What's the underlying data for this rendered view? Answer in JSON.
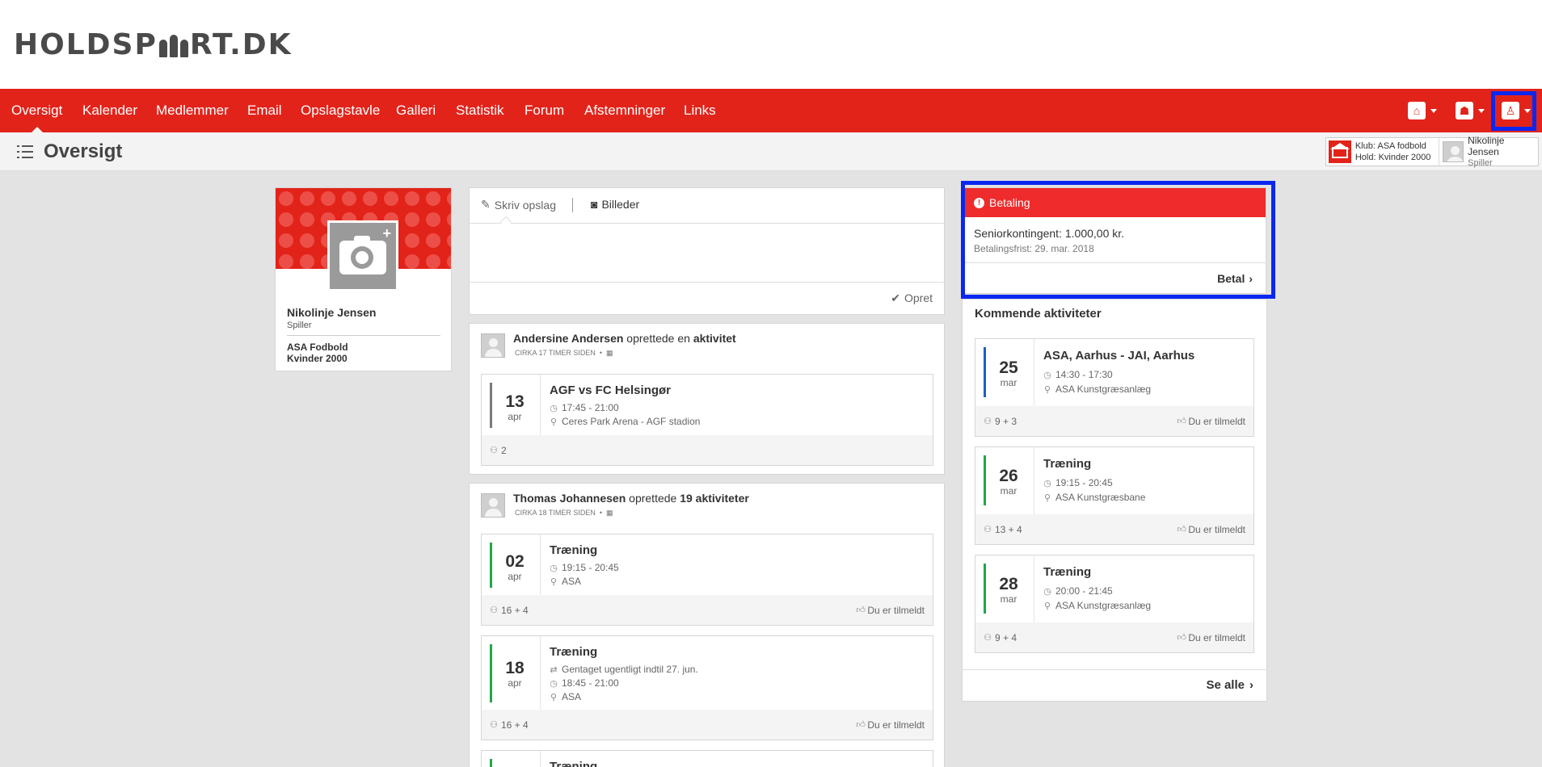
{
  "brand": {
    "logo": "HOLDSPORT.DK"
  },
  "nav": {
    "items": [
      {
        "label": "Oversigt"
      },
      {
        "label": "Kalender"
      },
      {
        "label": "Medlemmer"
      },
      {
        "label": "Email"
      },
      {
        "label": "Opslagstavle"
      },
      {
        "label": "Galleri"
      },
      {
        "label": "Statistik"
      },
      {
        "label": "Forum"
      },
      {
        "label": "Afstemninger"
      },
      {
        "label": "Links"
      }
    ]
  },
  "page": {
    "title": "Oversigt"
  },
  "context": {
    "club_label": "Klub: ASA fodbold",
    "team_label": "Hold: Kvinder 2000",
    "user_name": "Nikolinje Jensen",
    "user_role": "Spiller"
  },
  "profile": {
    "name": "Nikolinje Jensen",
    "role": "Spiller",
    "club": "ASA Fodbold",
    "team": "Kvinder 2000"
  },
  "composer": {
    "write_tab": "Skriv opslag",
    "images_tab": "Billeder",
    "create_button": "Opret"
  },
  "feed": [
    {
      "author": "Andersine Andersen",
      "verb": "oprettede en",
      "object": "aktivitet",
      "time": "CIRKA 17 TIMER SIDEN",
      "activities": [
        {
          "day": "13",
          "month": "apr",
          "title": "AGF vs FC Helsingør",
          "time": "17:45 - 21:00",
          "location": "Ceres Park Arena - AGF stadion",
          "count": "2",
          "status": ""
        }
      ]
    },
    {
      "author": "Thomas Johannesen",
      "verb": "oprettede",
      "object": "19 aktiviteter",
      "time": "CIRKA 18 TIMER SIDEN",
      "activities": [
        {
          "day": "02",
          "month": "apr",
          "title": "Træning",
          "time": "19:15 - 20:45",
          "location": "ASA",
          "count": "16 + 4",
          "status": "Du er tilmeldt"
        },
        {
          "day": "18",
          "month": "apr",
          "title": "Træning",
          "repeat": "Gentaget ugentligt indtil 27. jun.",
          "time": "18:45 - 21:00",
          "location": "ASA",
          "count": "16 + 4",
          "status": "Du er tilmeldt"
        },
        {
          "title": "Træning"
        }
      ]
    }
  ],
  "payment": {
    "header": "Betaling",
    "item": "Seniorkontingent: 1.000,00 kr.",
    "deadline": "Betalingsfrist: 29. mar. 2018",
    "pay_button": "Betal"
  },
  "upcoming": {
    "title": "Kommende aktiviteter",
    "see_all": "Se alle",
    "items": [
      {
        "day": "25",
        "month": "mar",
        "title": "ASA, Aarhus - JAI, Aarhus",
        "time": "14:30 - 17:30",
        "location": "ASA Kunstgræsanlæg",
        "count": "9 + 3",
        "status": "Du er tilmeldt",
        "color": "#1f5fbf"
      },
      {
        "day": "26",
        "month": "mar",
        "title": "Træning",
        "time": "19:15 - 20:45",
        "location": "ASA Kunstgræsbane",
        "count": "13 + 4",
        "status": "Du er tilmeldt",
        "color": "#21a64a"
      },
      {
        "day": "28",
        "month": "mar",
        "title": "Træning",
        "time": "20:00 - 21:45",
        "location": "ASA Kunstgræsanlæg",
        "count": "9 + 4",
        "status": "Du er tilmeldt",
        "color": "#21a64a"
      }
    ]
  },
  "colors": {
    "brand_red": "#e2231a",
    "payment_red": "#ef2b2b",
    "highlight_blue": "#0a27f0",
    "match_gray": "#7a7a7a",
    "training_green": "#21a64a"
  }
}
